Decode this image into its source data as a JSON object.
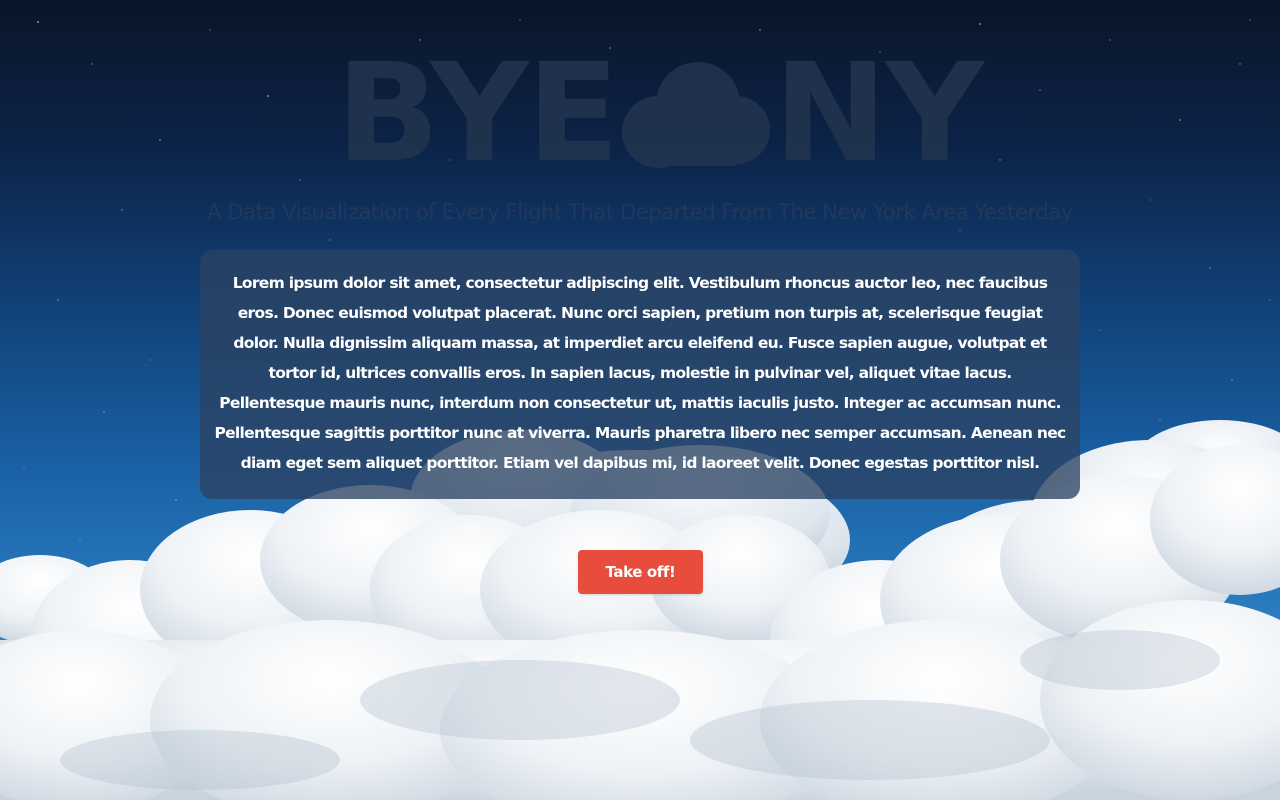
{
  "logo": {
    "text_left": "BYE",
    "text_right": "NY",
    "icon": "cloud-icon"
  },
  "subtitle": "A Data Visualization of Every Flight That Departed From The New York Area Yesterday",
  "description": "Lorem ipsum dolor sit amet, consectetur adipiscing elit. Vestibulum rhoncus auctor leo, nec faucibus eros. Donec euismod volutpat placerat. Nunc orci sapien, pretium non turpis at, scelerisque feugiat dolor. Nulla dignissim aliquam massa, at imperdiet arcu eleifend eu. Fusce sapien augue, volutpat et tortor id, ultrices convallis eros. In sapien lacus, molestie in pulvinar vel, aliquet vitae lacus. Pellentesque mauris nunc, interdum non consectetur ut, mattis iaculis justo. Integer ac accumsan nunc. Pellentesque sagittis porttitor nunc at viverra. Mauris pharetra libero nec semper accumsan. Aenean nec diam eget sem aliquet porttitor. Etiam vel dapibus mi, id laoreet velit. Donec egestas porttitor nisl.",
  "cta": {
    "label": "Take off!"
  },
  "colors": {
    "accent": "#e74c3c",
    "logo": "#24364f",
    "sky_top": "#0a1529",
    "sky_bottom": "#4a97d2",
    "panel": "#2c4363"
  }
}
